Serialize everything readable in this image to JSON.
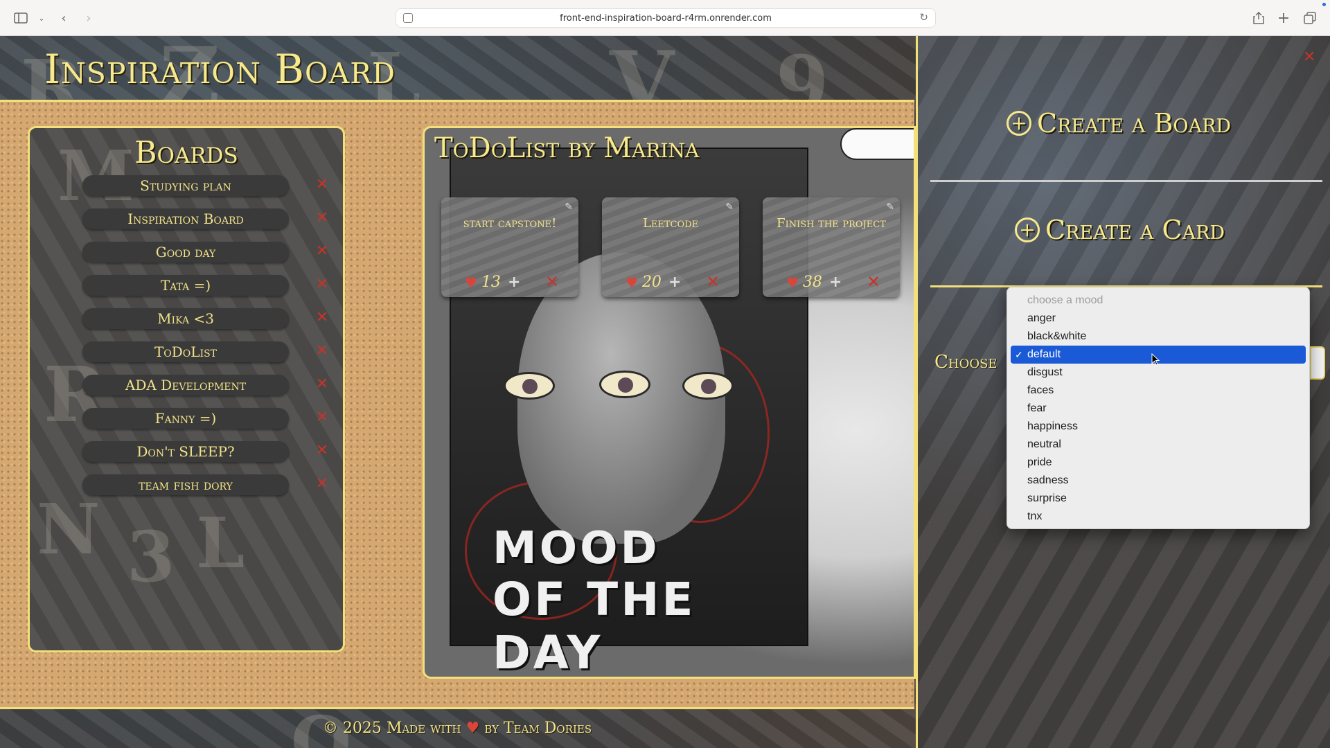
{
  "browser": {
    "url": "front-end-inspiration-board-r4rm.onrender.com"
  },
  "header": {
    "title": "Inspiration Board"
  },
  "boards_panel": {
    "title": "Boards",
    "items": [
      {
        "label": "Studying plan"
      },
      {
        "label": "Inspiration Board"
      },
      {
        "label": "Good day"
      },
      {
        "label": "Tata =)"
      },
      {
        "label": "Mika <3"
      },
      {
        "label": "ToDoList"
      },
      {
        "label": "ADA Development"
      },
      {
        "label": "Fanny =)"
      },
      {
        "label": "Don't SLEEP?"
      },
      {
        "label": "team fish dory"
      }
    ]
  },
  "board_display": {
    "title": "ToDoList by Marina",
    "poster_text_line1": "MOOD",
    "poster_text_line2": "OF THE DAY",
    "cards": [
      {
        "message": "start capstone!",
        "likes": "13"
      },
      {
        "message": "Leetcode",
        "likes": "20"
      },
      {
        "message": "Finish the project",
        "likes": "38"
      }
    ]
  },
  "side_panel": {
    "create_board_label": "Create a Board",
    "create_card_label": "Create a Card",
    "choose_label": "Choose"
  },
  "mood_dropdown": {
    "placeholder": "choose a mood",
    "selected": "default",
    "options": [
      "anger",
      "black&white",
      "default",
      "disgust",
      "faces",
      "fear",
      "happiness",
      "neutral",
      "pride",
      "sadness",
      "surprise",
      "tnx"
    ]
  },
  "footer": {
    "prefix": "© 2025 Made with",
    "suffix": "by Team Dories"
  },
  "colors": {
    "accent_yellow": "#f3e07a",
    "delete_red": "#c8332b",
    "heart_red": "#d8453a",
    "selection_blue": "#1a5ad6"
  }
}
